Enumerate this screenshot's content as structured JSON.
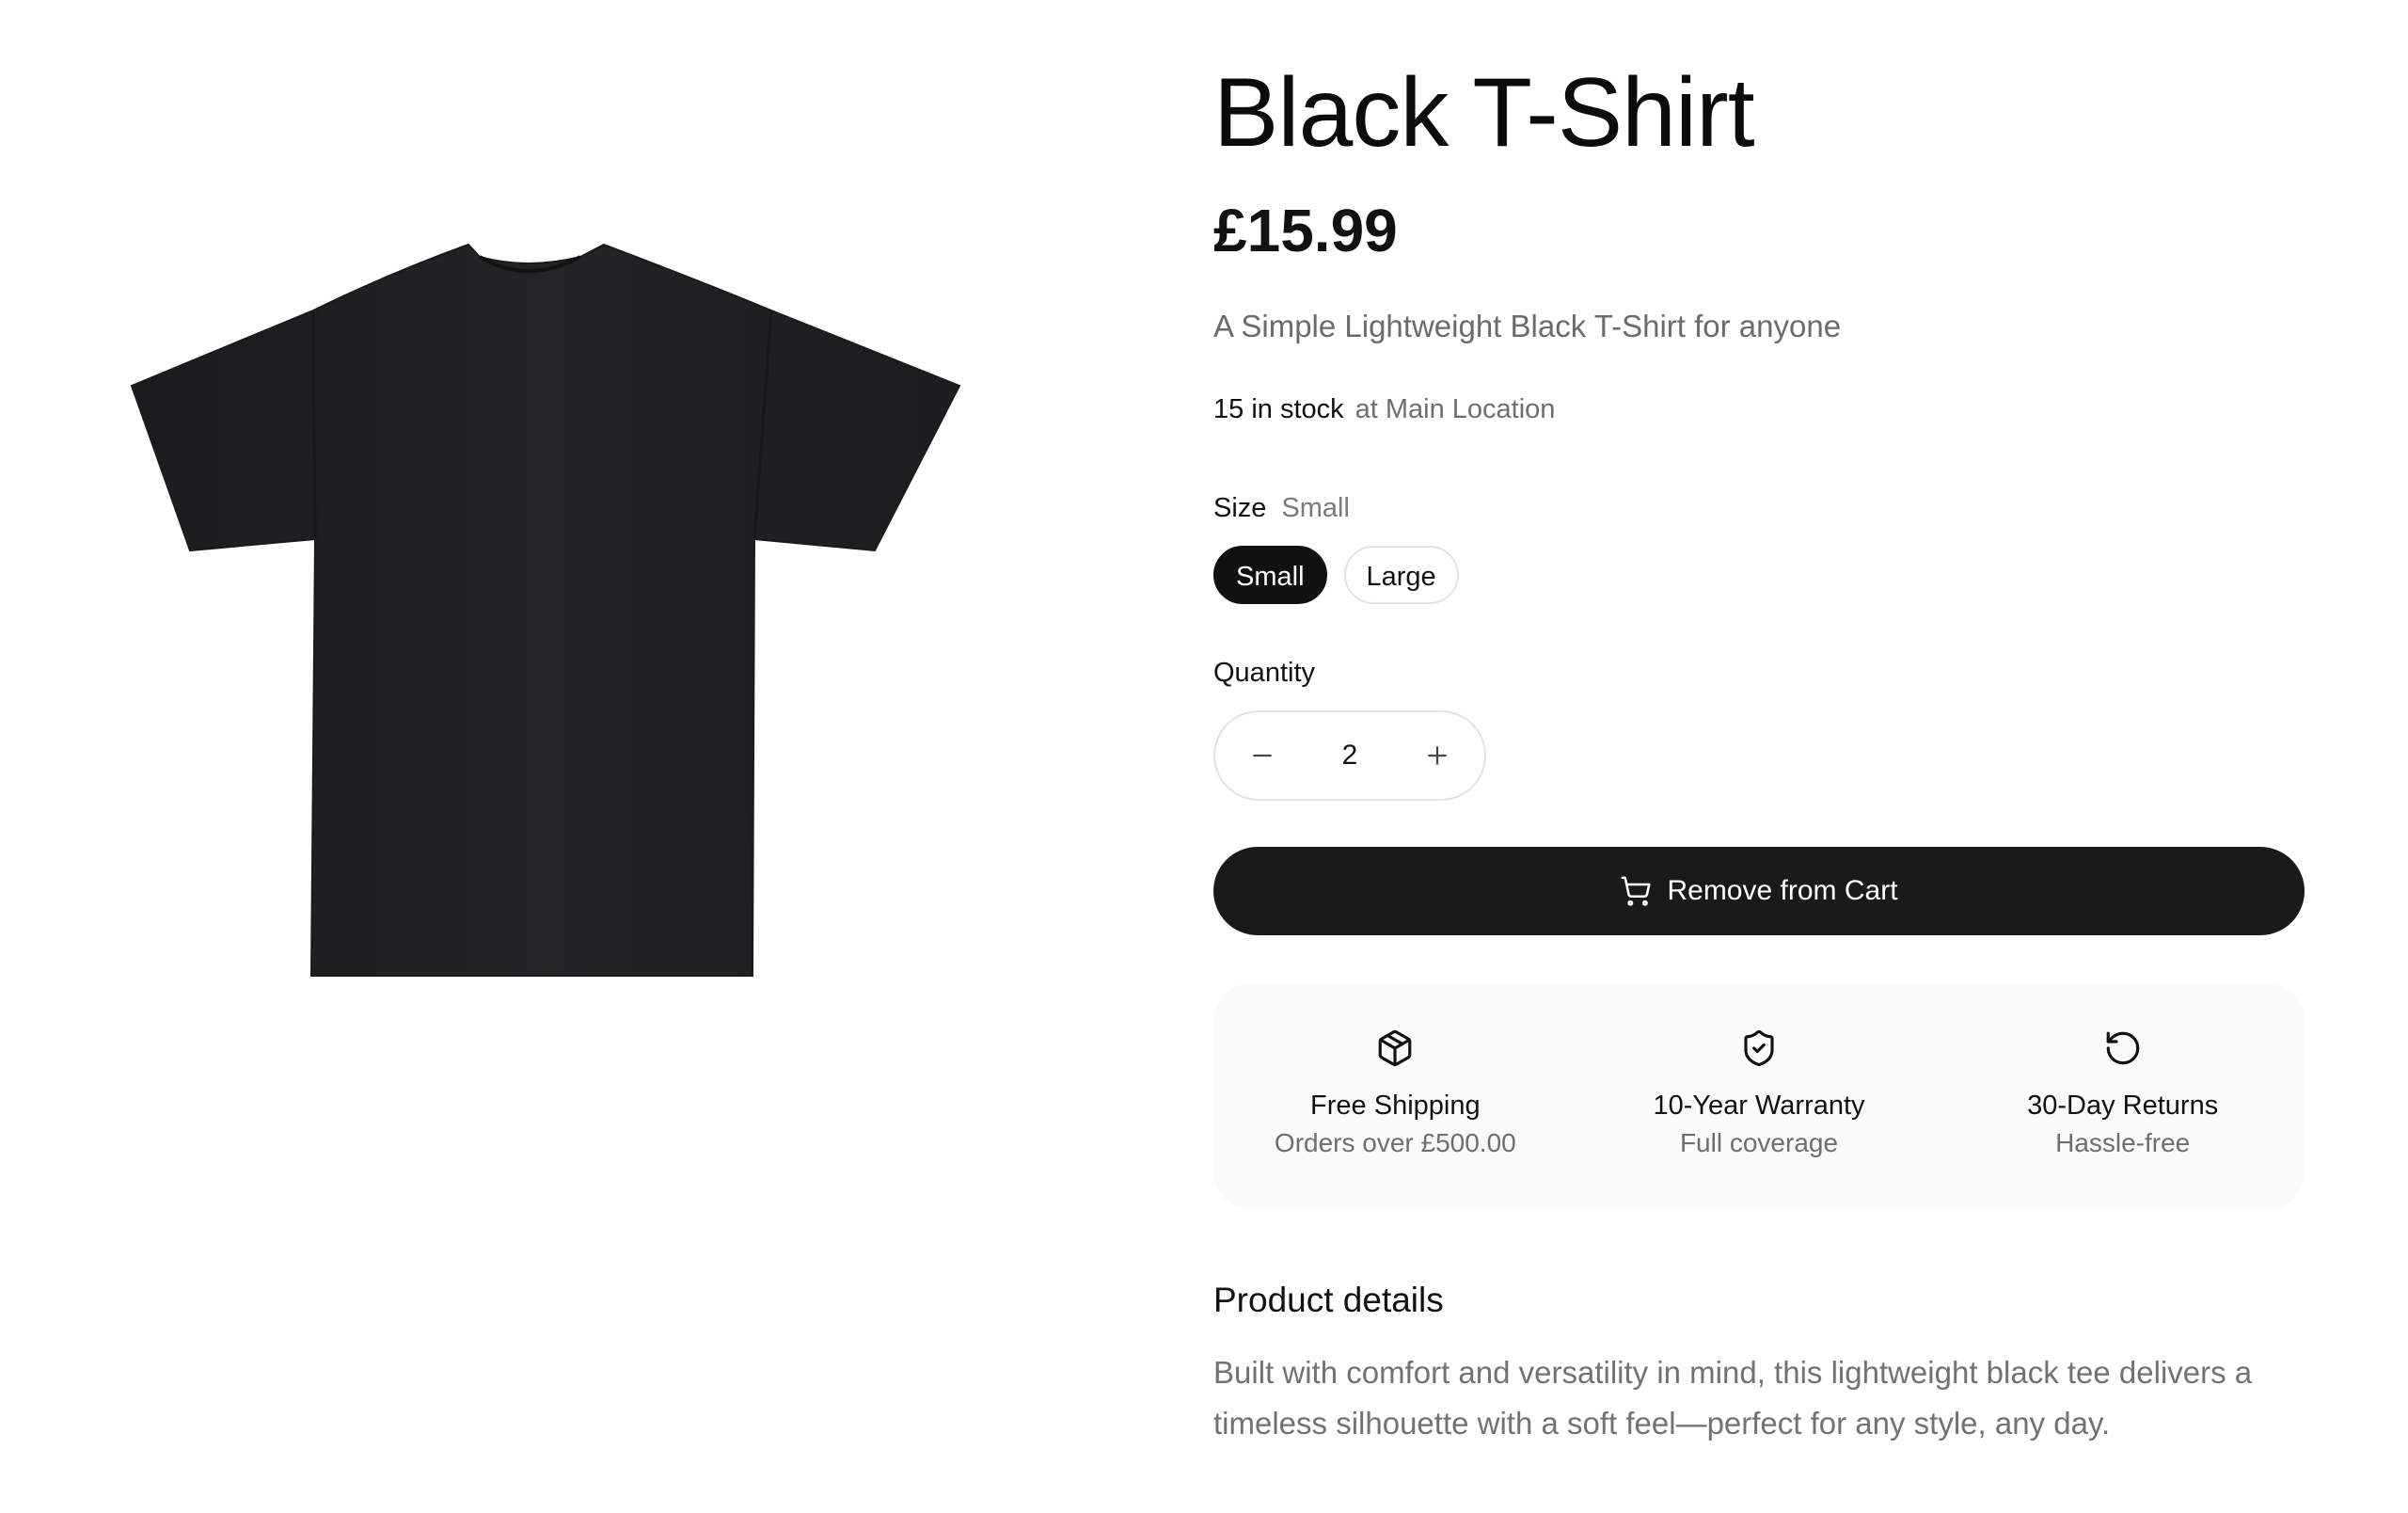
{
  "product": {
    "title": "Black T-Shirt",
    "price": "£15.99",
    "description": "A Simple Lightweight Black T-Shirt for anyone",
    "stock_count": "15 in stock",
    "stock_location": "at Main Location",
    "image_alt": "Black T-Shirt back view"
  },
  "size": {
    "label": "Size",
    "selected_value": "Small",
    "options": [
      "Small",
      "Large"
    ]
  },
  "quantity": {
    "label": "Quantity",
    "value": "2"
  },
  "cart_button": {
    "label": "Remove from Cart",
    "icon": "cart-icon"
  },
  "features": [
    {
      "icon": "package-icon",
      "title": "Free Shipping",
      "subtitle": "Orders over £500.00"
    },
    {
      "icon": "shield-check-icon",
      "title": "10-Year Warranty",
      "subtitle": "Full coverage"
    },
    {
      "icon": "rotate-ccw-icon",
      "title": "30-Day Returns",
      "subtitle": "Hassle-free"
    }
  ],
  "details": {
    "title": "Product details",
    "text": "Built with comfort and versatility in mind, this lightweight black tee delivers a timeless silhouette with a soft feel—perfect for any style, any day."
  },
  "colors": {
    "primary": "#1a1a1a",
    "muted_text": "#6e6e6e",
    "border": "#e3e3e3",
    "feature_bg": "#fafafa"
  }
}
